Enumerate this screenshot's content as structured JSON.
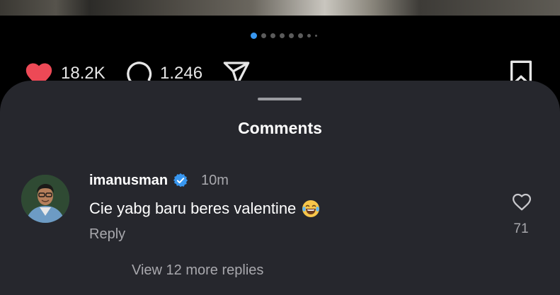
{
  "post": {
    "carousel": {
      "total_dots": 8,
      "active_index": 0
    },
    "actions": {
      "likes_count": "18.2K",
      "comments_count": "1.246"
    },
    "icons": {
      "like": "heart-filled-icon",
      "comment": "comment-bubble-icon",
      "share": "send-icon",
      "save": "bookmark-icon"
    },
    "colors": {
      "like": "#ed4956",
      "accent": "#3897f0"
    }
  },
  "comments_sheet": {
    "title": "Comments",
    "background": "#26272d",
    "comment": {
      "username": "imanusman",
      "verified": true,
      "time": "10m",
      "text": "Cie yabg baru beres valentine",
      "emoji": "laughing-tears-emoji",
      "reply_label": "Reply",
      "likes": "71"
    },
    "view_more_label": "View 12 more replies"
  }
}
